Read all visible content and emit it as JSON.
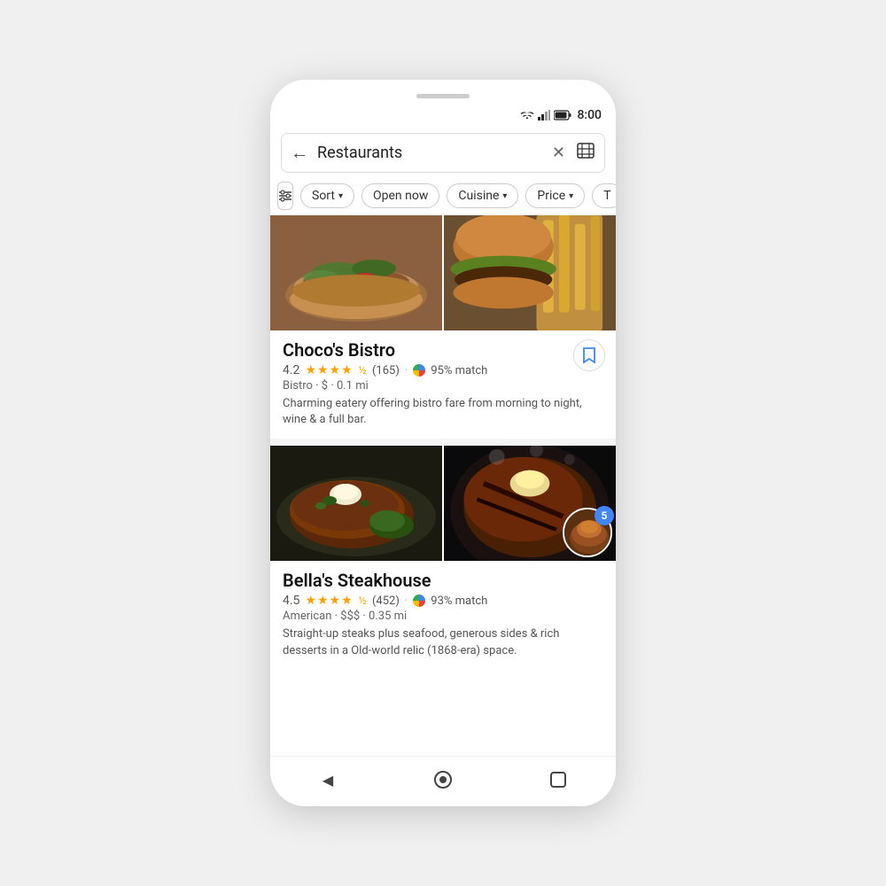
{
  "phone": {
    "status_bar": {
      "time": "8:00"
    },
    "search_bar": {
      "query": "Restaurants",
      "back_icon": "back-arrow-icon",
      "clear_icon": "clear-icon",
      "map_icon": "map-icon"
    },
    "filter_chips": [
      {
        "id": "filter-icon-chip",
        "label": "",
        "type": "icon"
      },
      {
        "id": "sort-chip",
        "label": "Sort",
        "has_arrow": true
      },
      {
        "id": "open-now-chip",
        "label": "Open now",
        "has_arrow": false
      },
      {
        "id": "cuisine-chip",
        "label": "Cuisine",
        "has_arrow": true
      },
      {
        "id": "price-chip",
        "label": "Price",
        "has_arrow": true
      },
      {
        "id": "more-chip",
        "label": "T",
        "has_arrow": false
      }
    ],
    "restaurants": [
      {
        "id": "chocos-bistro",
        "name": "Choco's Bistro",
        "rating": "4.2",
        "stars_display": "★★★★½",
        "review_count": "(165)",
        "match_percent": "95% match",
        "category": "Bistro",
        "price": "$",
        "distance": "0.1 mi",
        "description": "Charming eatery offering bistro fare from morning to night, wine & a full bar.",
        "has_bookmark": true,
        "has_avatar": false
      },
      {
        "id": "bellas-steakhouse",
        "name": "Bella's Steakhouse",
        "rating": "4.5",
        "stars_display": "★★★★½",
        "review_count": "(452)",
        "match_percent": "93% match",
        "category": "American",
        "price": "$$$",
        "distance": "0.35 mi",
        "description": "Straight-up steaks plus seafood, generous sides & rich desserts in a Old-world relic (1868-era) space.",
        "has_bookmark": false,
        "has_avatar": true,
        "avatar_badge": "5"
      }
    ],
    "nav_bar": {
      "back_label": "◀",
      "home_label": "⬤",
      "square_label": "■"
    }
  }
}
